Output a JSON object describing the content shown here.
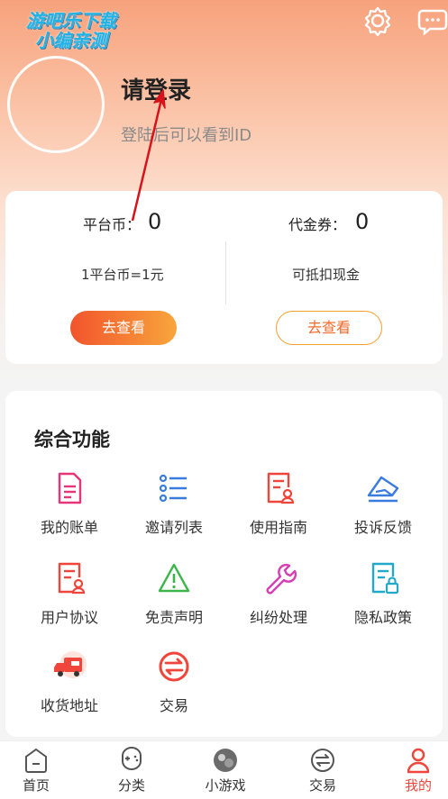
{
  "watermark": {
    "line1": "游吧乐下载",
    "line2": "小编亲测"
  },
  "profile": {
    "title": "请登录",
    "subtitle": "登陆后可以看到ID"
  },
  "wallet": {
    "platform": {
      "label": "平台币：",
      "value": "0",
      "note": "1平台币=1元",
      "button": "去查看"
    },
    "voucher": {
      "label": "代金券：",
      "value": "0",
      "note": "可抵扣现金",
      "button": "去查看"
    }
  },
  "features": {
    "title": "综合功能",
    "items": [
      {
        "label": "我的账单",
        "icon": "bill-icon"
      },
      {
        "label": "邀请列表",
        "icon": "list-icon"
      },
      {
        "label": "使用指南",
        "icon": "guide-icon"
      },
      {
        "label": "投诉反馈",
        "icon": "feedback-icon"
      },
      {
        "label": "用户协议",
        "icon": "agreement-icon"
      },
      {
        "label": "免责声明",
        "icon": "warning-icon"
      },
      {
        "label": "纠纷处理",
        "icon": "wrench-icon"
      },
      {
        "label": "隐私政策",
        "icon": "privacy-icon"
      },
      {
        "label": "收货地址",
        "icon": "delivery-truck-icon"
      },
      {
        "label": "交易",
        "icon": "exchange-icon"
      }
    ]
  },
  "tabbar": {
    "items": [
      {
        "label": "首页",
        "icon": "home-icon"
      },
      {
        "label": "分类",
        "icon": "gamepad-icon"
      },
      {
        "label": "小游戏",
        "icon": "minigame-icon"
      },
      {
        "label": "交易",
        "icon": "trade-icon"
      },
      {
        "label": "我的",
        "icon": "user-icon",
        "active": true
      }
    ]
  },
  "colors": {
    "accent": "#f0453a",
    "orange": "#f6a02e",
    "pink": "#e8357a",
    "blue": "#3a7be0",
    "green": "#3cb64a"
  }
}
